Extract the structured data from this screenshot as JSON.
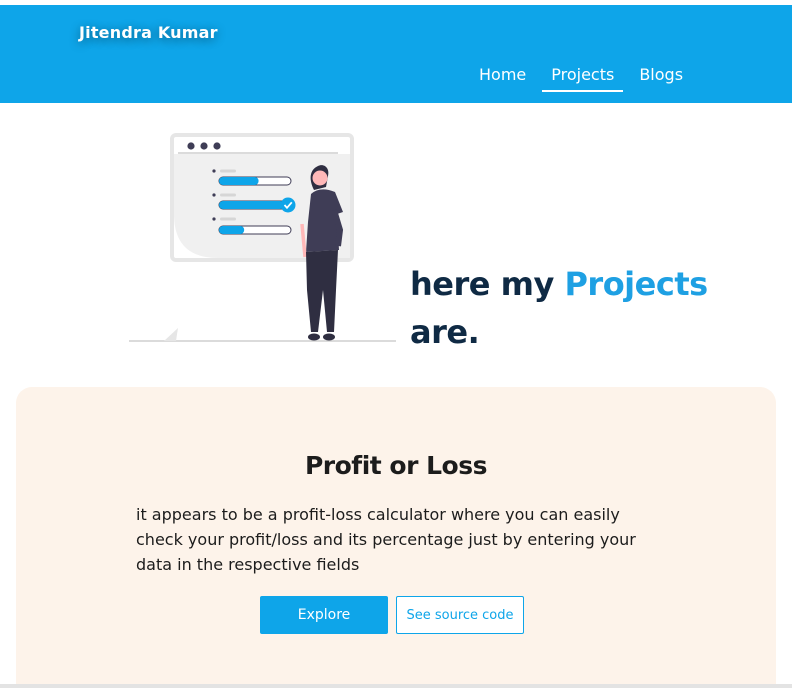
{
  "nav": {
    "brand": "Jitendra Kumar",
    "links": [
      {
        "label": "Home",
        "active": false
      },
      {
        "label": "Projects",
        "active": true
      },
      {
        "label": "Blogs",
        "active": false
      }
    ]
  },
  "hero": {
    "title_prefix": "here my ",
    "title_accent": "Projects",
    "title_suffix": "are."
  },
  "project": {
    "title": "Profit or Loss",
    "description": "it appears to be a profit-loss calculator where you can easily check your profit/loss and its percentage just by entering your data in the respective fields",
    "explore_label": "Explore",
    "source_label": "See source code"
  },
  "illustration": {
    "progress": [
      0.55,
      0.9,
      0.35
    ],
    "check_on_item": 2
  },
  "colors": {
    "header_bg": "#0ea5e9",
    "accent": "#1ea0e3",
    "card_bg": "#fdf3ea",
    "heading": "#0f2a44"
  }
}
